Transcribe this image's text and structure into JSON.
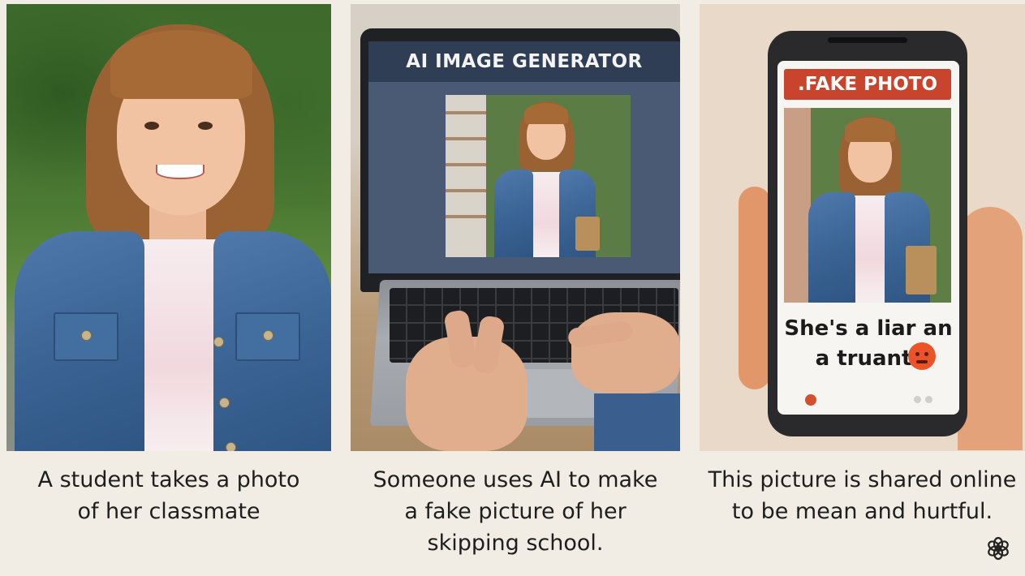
{
  "panels": [
    {
      "caption": "A student takes a photo\nof her classmate"
    },
    {
      "screen_title": "AI IMAGE GENERATOR",
      "caption": "Someone uses AI to make\na fake picture of her\nskipping school."
    },
    {
      "label": ".FAKE PHOTO",
      "post_text": "She's a liar an\na truant!",
      "caption": "This picture is shared online\nto be mean and hurtful."
    }
  ],
  "colors": {
    "background": "#f1ede4",
    "fake_label": "#c8442d",
    "screen_header": "#2f3d55",
    "denim": "#3b6595"
  },
  "icons": [
    "angry-face-icon",
    "openai-logo-icon"
  ]
}
